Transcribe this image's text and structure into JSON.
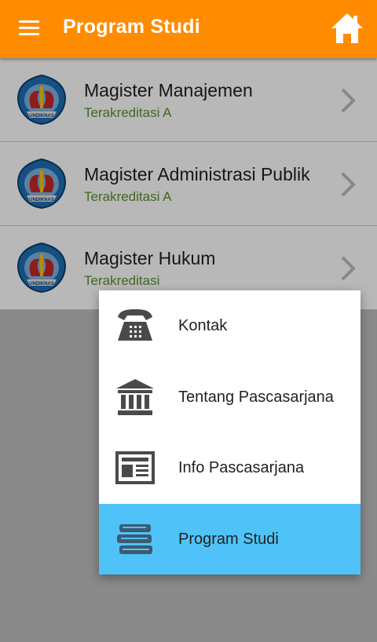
{
  "appbar": {
    "title": "Program Studi",
    "menu_icon": "hamburger-icon",
    "home_icon": "home-icon",
    "color": "#ff8c00"
  },
  "programs": [
    {
      "title": "Magister Manajemen",
      "status": "Terakreditasi A",
      "logo": "undiknas-logo"
    },
    {
      "title": "Magister Administrasi Publik",
      "status": "Terakreditasi A",
      "logo": "undiknas-logo"
    },
    {
      "title": "Magister Hukum",
      "status": "Terakreditasi",
      "logo": "undiknas-logo"
    }
  ],
  "menu": {
    "items": [
      {
        "label": "Kontak",
        "icon": "telephone-icon",
        "active": false
      },
      {
        "label": "Tentang Pascasarjana",
        "icon": "institution-icon",
        "active": false
      },
      {
        "label": "Info Pascasarjana",
        "icon": "newspaper-icon",
        "active": false
      },
      {
        "label": "Program Studi",
        "icon": "books-icon",
        "active": true
      }
    ],
    "active_color": "#4fc3f7"
  },
  "colors": {
    "status_green": "#5a8f2c"
  }
}
